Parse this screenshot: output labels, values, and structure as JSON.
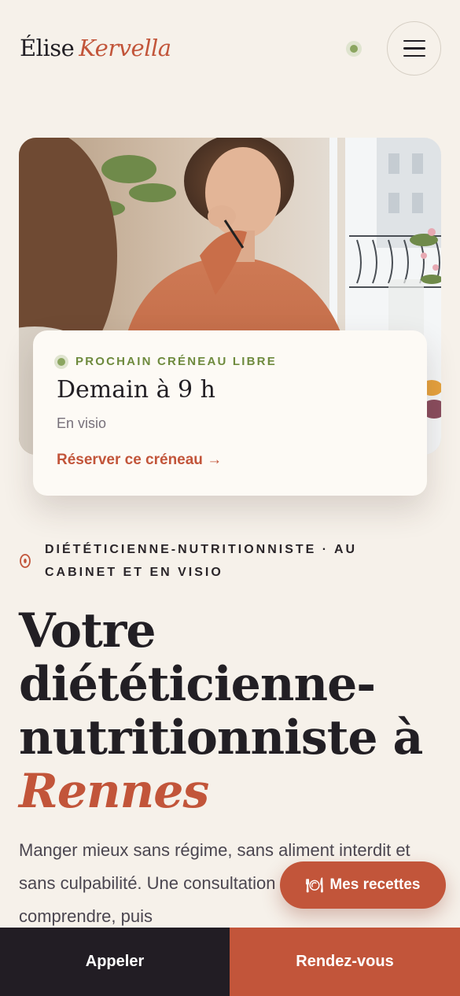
{
  "header": {
    "first_name": "Élise",
    "last_name": "Kervella",
    "menu_icon": "hamburger-icon",
    "status_icon": "online-dot-icon"
  },
  "slot": {
    "eyebrow": "PROCHAIN CRÉNEAU LIBRE",
    "title": "Demain à 9 h",
    "mode": "En visio",
    "cta": "Réserver ce créneau →"
  },
  "hero": {
    "kicker": "DIÉTÉTICIENNE-NUTRITIONNISTE · AU CABINET ET EN VISIO",
    "kicker_icon": "location-pin-icon",
    "headline_main": "Votre diététicienne-nutritionniste à",
    "headline_city": "Rennes",
    "intro": "Manger mieux sans régime, sans aliment interdit et sans culpabilité. Une consultation d’une heure pour comprendre, puis"
  },
  "floating": {
    "recipes_icon": "plate-cutlery-icon",
    "recipes_label": "Mes recettes"
  },
  "actions": {
    "call_label": "Appeler",
    "booking_label": "Rendez-vous"
  },
  "colors": {
    "background": "#f6f1ea",
    "accent": "#c2553a",
    "dark": "#221d24",
    "green": "#8ba560"
  }
}
